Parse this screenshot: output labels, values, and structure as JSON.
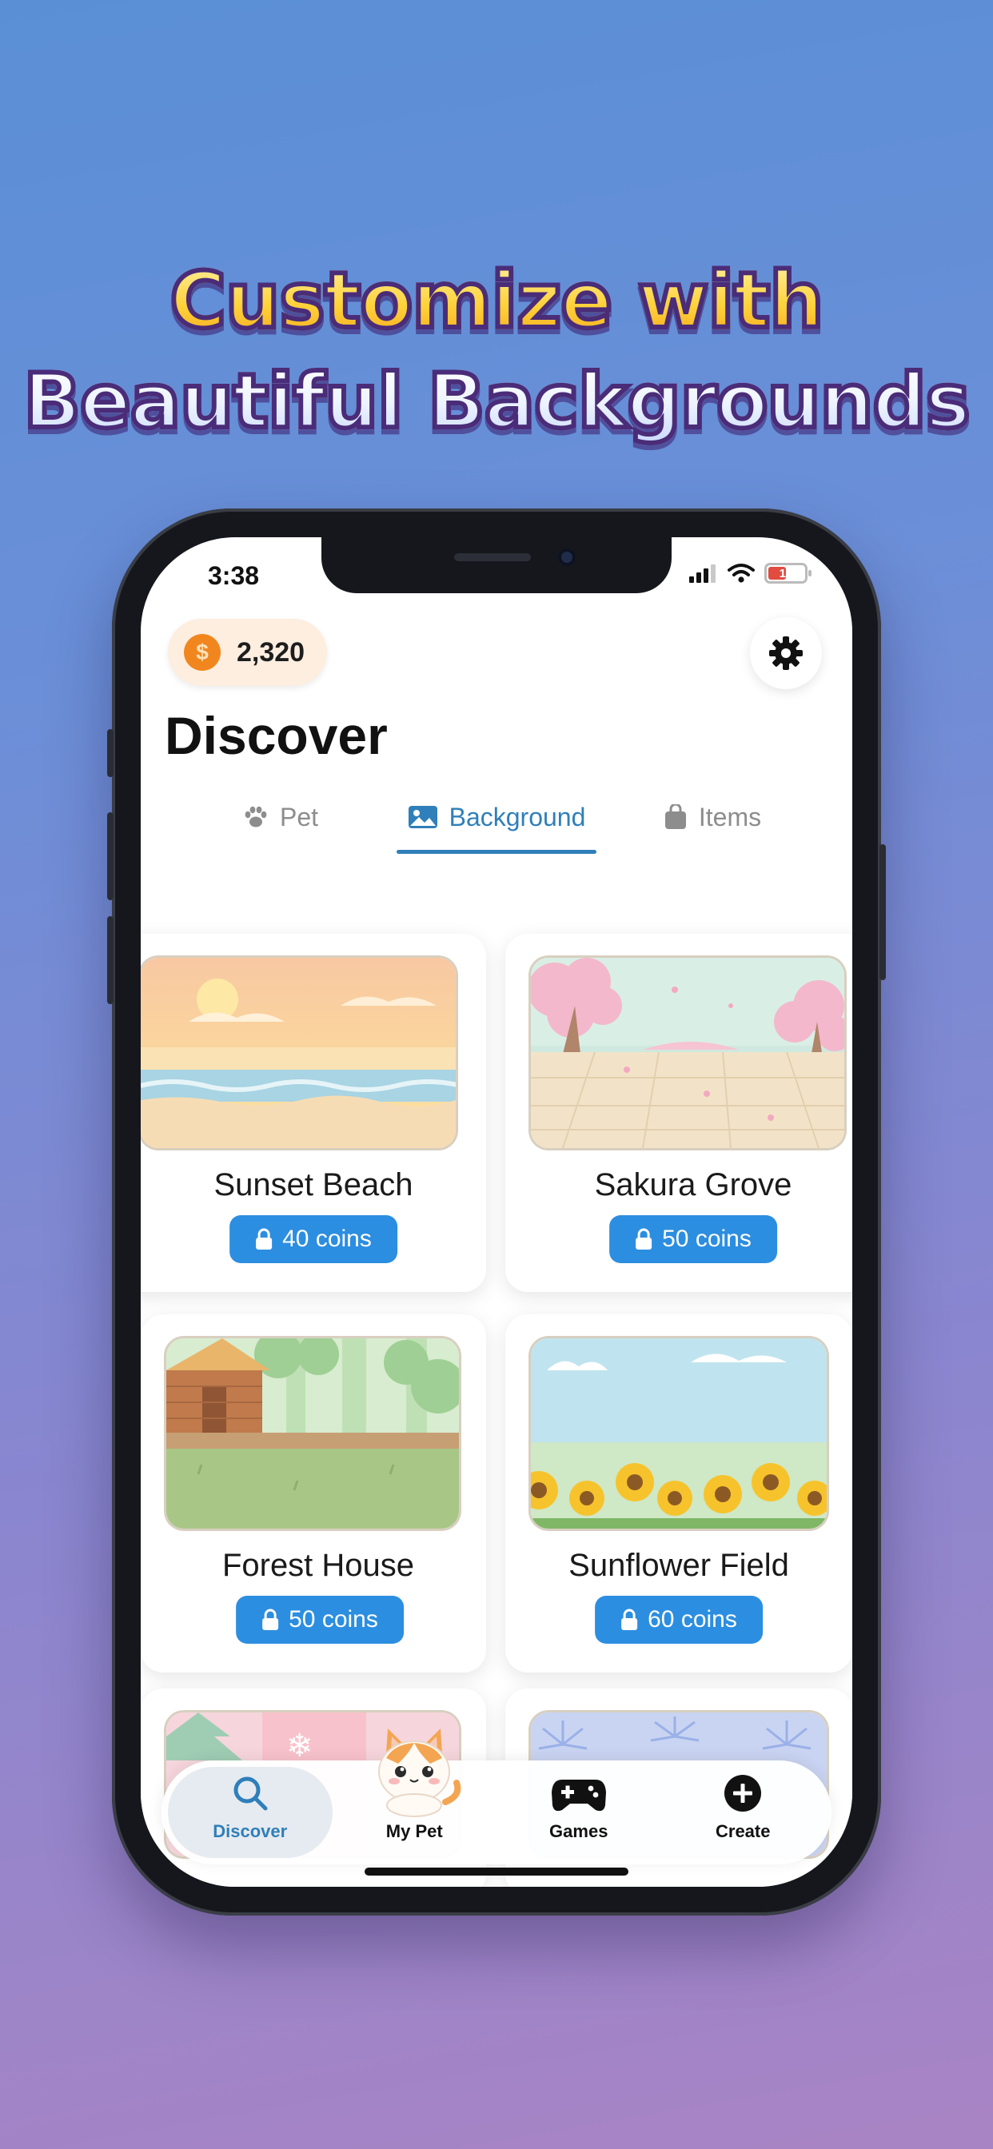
{
  "headline": {
    "line1": "Customize with",
    "line2": "Beautiful Backgrounds"
  },
  "status_bar": {
    "time": "3:38",
    "battery": "14"
  },
  "header": {
    "coins": "2,320",
    "coin_symbol": "$",
    "title": "Discover"
  },
  "tabs": [
    {
      "label": "Pet",
      "icon": "paw-icon",
      "active": false
    },
    {
      "label": "Background",
      "icon": "image-icon",
      "active": true
    },
    {
      "label": "Items",
      "icon": "bag-icon",
      "active": false
    }
  ],
  "backgrounds": [
    {
      "name": "Sunset Beach",
      "price": "40 coins",
      "icon": "lock-icon"
    },
    {
      "name": "Sakura Grove",
      "price": "50 coins",
      "icon": "lock-icon"
    },
    {
      "name": "Forest House",
      "price": "50 coins",
      "icon": "lock-icon"
    },
    {
      "name": "Sunflower Field",
      "price": "60 coins",
      "icon": "lock-icon"
    }
  ],
  "bottom_nav": [
    {
      "label": "Discover",
      "icon": "search-icon",
      "active": true
    },
    {
      "label": "My Pet",
      "icon": "cat-icon",
      "active": false
    },
    {
      "label": "Games",
      "icon": "gamepad-icon",
      "active": false
    },
    {
      "label": "Create",
      "icon": "plus-circle-icon",
      "active": false
    }
  ],
  "colors": {
    "accent": "#2f7fba",
    "price_button": "#2c8ee0",
    "coin": "#f2861e"
  }
}
